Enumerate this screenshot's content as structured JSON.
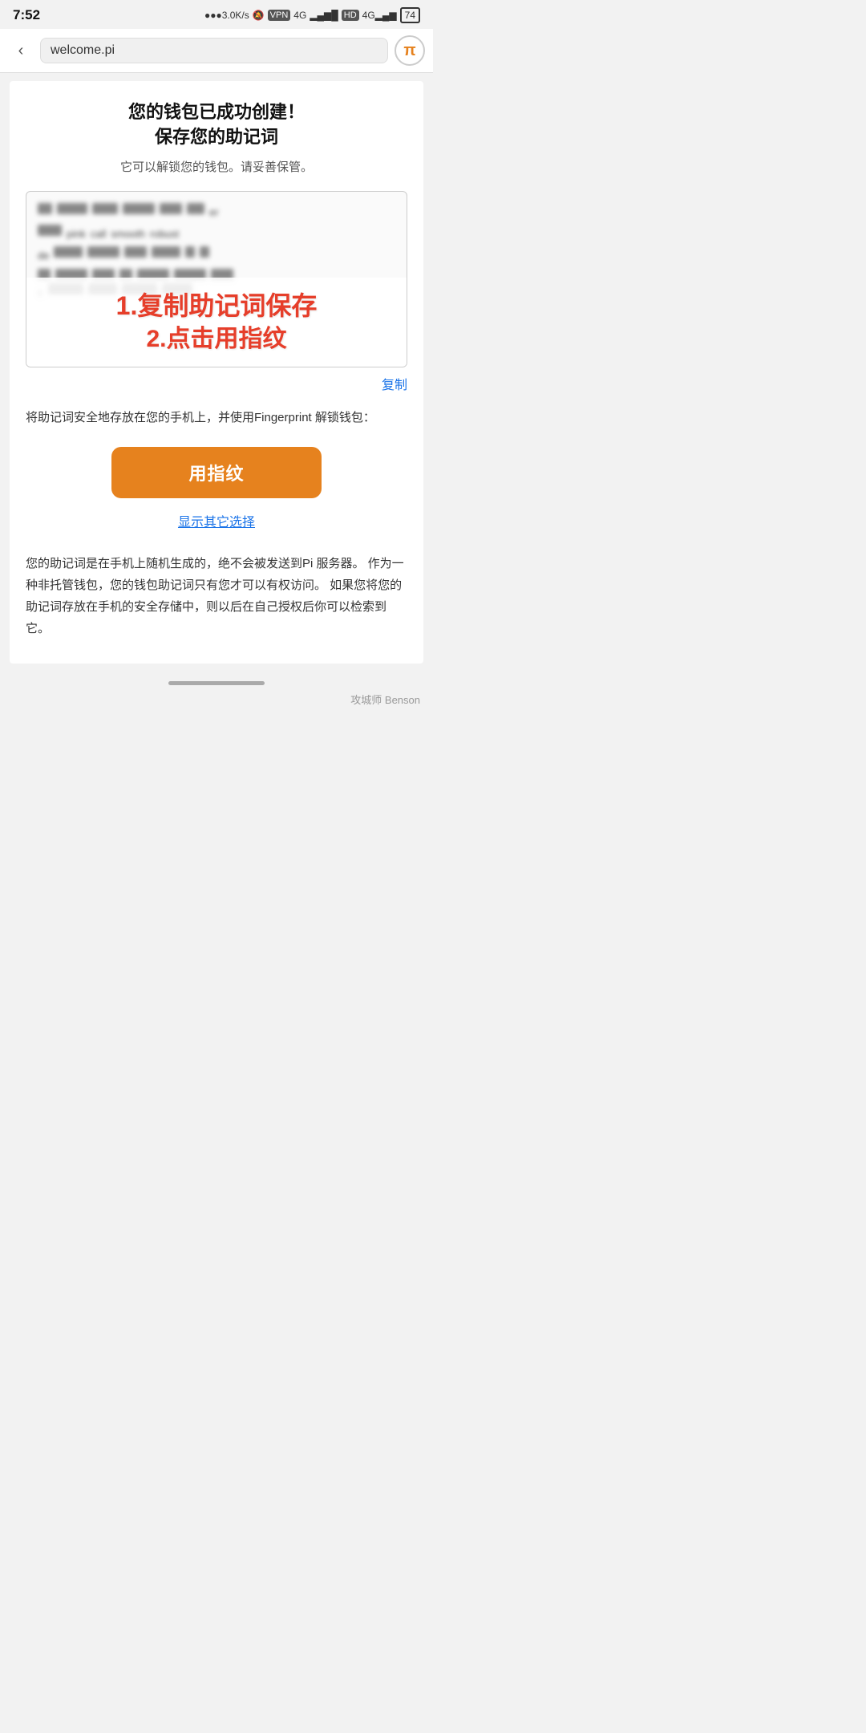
{
  "statusBar": {
    "time": "7:52",
    "signal": "●●●3.0K/s",
    "vpn": "VPN",
    "battery": "74"
  },
  "browserBar": {
    "backIcon": "‹",
    "url": "welcome.pi",
    "logoIcon": "π"
  },
  "page": {
    "title": "您的钱包已成功创建！ \\n 保存您的助记词",
    "subtitle": "它可以解锁您的钱包。请妥善保管。",
    "mnemonicWords": [
      [
        "e1",
        "■■■",
        "■■■■",
        "■■■■",
        "■■■",
        "■■",
        "er"
      ],
      [
        "■■■",
        "pink",
        "call",
        "smooth",
        "robust"
      ],
      [
        "de■",
        "■■■■",
        "■■■■",
        "■■■",
        "■■■■",
        "■",
        "■"
      ],
      [
        "■",
        "■■■■",
        "■■■",
        "■",
        "■■■■",
        "■■■■",
        "■■■"
      ],
      [
        "c■",
        "■■■■■",
        "■■■■",
        "■■■■■",
        "■■■■"
      ]
    ],
    "overlayText1": "1.复制助记词保存",
    "overlayText2": "2.点击用指纹",
    "copyLabel": "复制",
    "descriptionText": "将助记词安全地存放在您的手机上，并使用Fingerprint 解锁钱包：",
    "fingerprintButtonLabel": "用指纹",
    "showOtherLabel": "显示其它选择",
    "infoText": "您的助记词是在手机上随机生成的，绝不会被发送到Pi 服务器。 作为一种非托管钱包，您的钱包助记词只有您才可以有权访问。 如果您将您的助记词存放在手机的安全存储中，则以后在自己授权后你可以检索到它。"
  },
  "bottomBar": {
    "watermark": "攻城师 Benson"
  }
}
